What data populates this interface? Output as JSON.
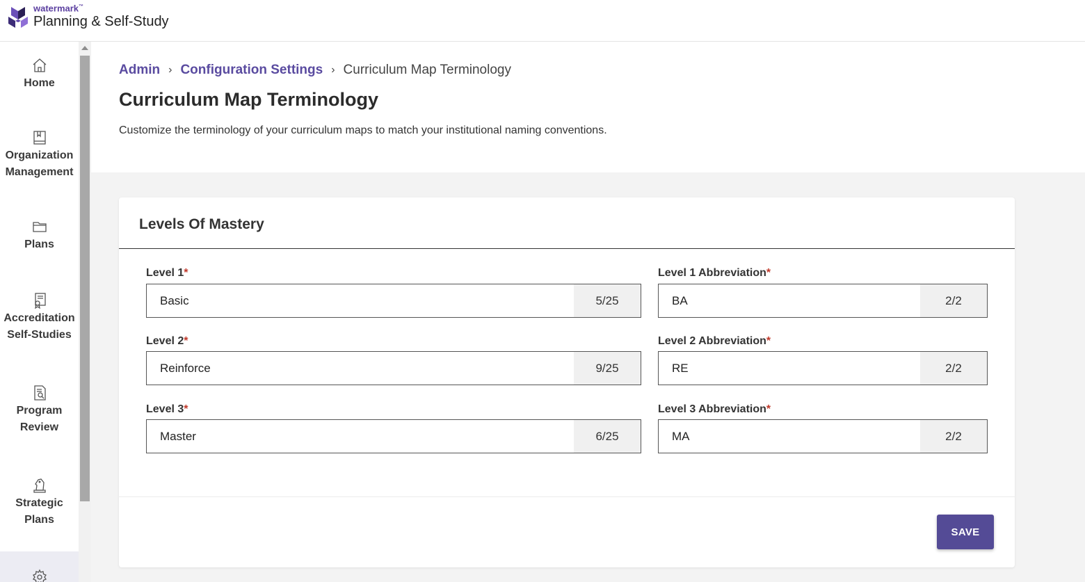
{
  "app": {
    "brand": "watermark",
    "product": "Planning & Self-Study"
  },
  "sidebar": {
    "items": [
      {
        "label": "Home",
        "icon": "home-icon"
      },
      {
        "label_line1": "Organization",
        "label_line2": "Management",
        "icon": "book-icon"
      },
      {
        "label": "Plans",
        "icon": "folder-icon"
      },
      {
        "label_line1": "Accreditation",
        "label_line2": "Self-Studies",
        "icon": "certificate-icon"
      },
      {
        "label_line1": "Program",
        "label_line2": "Review",
        "icon": "document-search-icon"
      },
      {
        "label_line1": "Strategic",
        "label_line2": "Plans",
        "icon": "chess-knight-icon"
      },
      {
        "label": "",
        "icon": "gear-icon"
      }
    ]
  },
  "breadcrumb": {
    "admin": "Admin",
    "config": "Configuration Settings",
    "current": "Curriculum Map Terminology",
    "separator": "›"
  },
  "page": {
    "title": "Curriculum Map Terminology",
    "description": "Customize the terminology of your curriculum maps to match your institutional naming conventions."
  },
  "card": {
    "title": "Levels Of Mastery",
    "required_mark": "*",
    "levels": [
      {
        "label": "Level 1",
        "value": "Basic",
        "count": "5/25",
        "abbr_label": "Level 1 Abbreviation",
        "abbr_value": "BA",
        "abbr_count": "2/2"
      },
      {
        "label": "Level 2",
        "value": "Reinforce",
        "count": "9/25",
        "abbr_label": "Level 2 Abbreviation",
        "abbr_value": "RE",
        "abbr_count": "2/2"
      },
      {
        "label": "Level 3",
        "value": "Master",
        "count": "6/25",
        "abbr_label": "Level 3 Abbreviation",
        "abbr_value": "MA",
        "abbr_count": "2/2"
      }
    ],
    "save_label": "SAVE"
  },
  "colors": {
    "accent": "#544b96",
    "link": "#5a4ba0",
    "required": "#c0392b"
  }
}
